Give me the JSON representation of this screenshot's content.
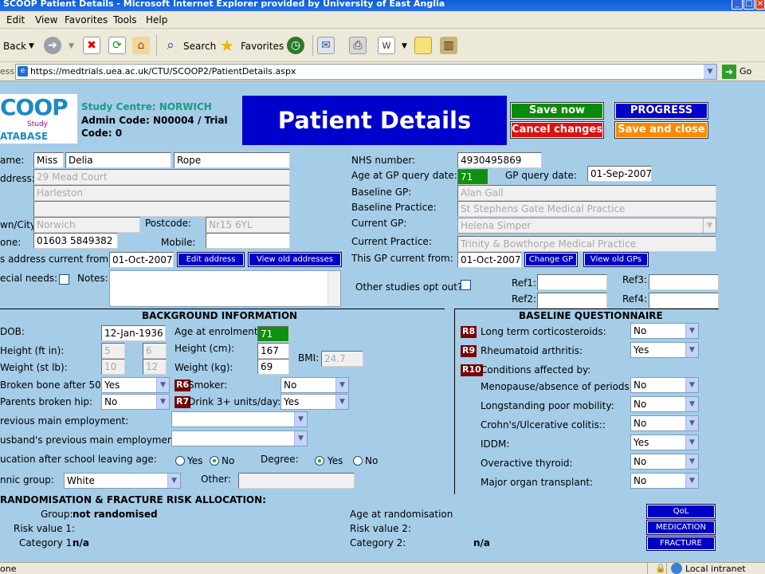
{
  "window": {
    "title": "SCOOP Patient Details - Microsoft Internet Explorer provided by University of East Anglia"
  },
  "menu": [
    "Edit",
    "View",
    "Favorites",
    "Tools",
    "Help"
  ],
  "toolbar": {
    "back": "Back",
    "search": "Search",
    "favorites": "Favorites"
  },
  "address": {
    "label": "ess",
    "url": "https://medtrials.uea.ac.uk/CTU/SCOOP2/PatientDetails.aspx",
    "go": "Go"
  },
  "header": {
    "logo_text": "COOP",
    "logo_study": "Study",
    "logo_database": "ATABASE",
    "centre": "Study Centre: NORWICH",
    "admin_line1": "Admin Code: N00004 / Trial",
    "admin_line2": "Code: 0",
    "page_title": "Patient Details",
    "save_now": "Save now",
    "cancel_changes": "Cancel changes",
    "progress": "PROGRESS",
    "save_and_close": "Save and close"
  },
  "patient": {
    "name_label": "ame:",
    "title": "Miss",
    "first_name": "Delia",
    "surname": "Rope",
    "address_label": "ddress:",
    "address1": "29 Mead Court",
    "address2": "Harleston",
    "address3": "",
    "town_label": "wn/City:",
    "town": "Norwich",
    "postcode_label": "Postcode:",
    "postcode": "Nr15 6YL",
    "phone_label": "one:",
    "phone": "01603 5849382",
    "mobile_label": "Mobile:",
    "mobile": "",
    "address_from_label": "s address current from:",
    "address_from": "01-Oct-2007",
    "edit_address": "Edit address",
    "view_old_addresses": "View old addresses",
    "special_needs_label": "ecial needs:",
    "notes_label": "Notes:"
  },
  "gp": {
    "nhs_label": "NHS number:",
    "nhs": "4930495869",
    "age_gp_label": "Age at GP query date:",
    "age_gp": "71",
    "gp_query_label": "GP query date:",
    "gp_query_date": "01-Sep-2007",
    "baseline_gp_label": "Baseline GP:",
    "baseline_gp": "Alan  Gall",
    "baseline_practice_label": "Baseline Practice:",
    "baseline_practice": "St Stephens Gate Medical Practice",
    "current_gp_label": "Current GP:",
    "current_gp": "Helena Simper",
    "current_practice_label": "Current Practice:",
    "current_practice": "Trinity & Bowthorpe Medical Practice",
    "gp_from_label": "This GP current from:",
    "gp_from": "01-Oct-2007",
    "change_gp": "Change GP",
    "view_old_gps": "View old GPs",
    "opt_out_label": "Other studies opt out?:",
    "ref1_label": "Ref1:",
    "ref2_label": "Ref2:",
    "ref3_label": "Ref3:",
    "ref4_label": "Ref4:"
  },
  "background": {
    "heading": "BACKGROUND INFORMATION",
    "dob_label": "DOB:",
    "dob": "12-Jan-1936",
    "age_enrol_label": "Age at enrolment:",
    "age_enrol": "71",
    "height_ftin_label": "Height (ft in):",
    "height_ft": "5",
    "height_in": "6",
    "height_cm_label": "Height (cm):",
    "height_cm": "167",
    "weight_stlb_label": "Weight (st lb):",
    "weight_st": "10",
    "weight_lb": "12",
    "weight_kg_label": "Weight (kg):",
    "weight_kg": "69",
    "bmi_label": "BMI:",
    "bmi": "24.7",
    "broken_label": "Broken bone after 50:",
    "broken": "Yes",
    "parents_label": "Parents broken hip:",
    "parents": "No",
    "r6": "R6",
    "smoker_label": "Smoker:",
    "smoker": "No",
    "r7": "R7",
    "drink_label": "Drink 3+ units/day:",
    "drink": "Yes",
    "employment_label": "revious main employment:",
    "husband_label": "usband's previous main employment:",
    "education_label": "ucation after school leaving age:",
    "yes": "Yes",
    "no": "No",
    "degree_label": "Degree:",
    "ethnic_label": "nnic group:",
    "ethnic": "White",
    "other_label": "Other:"
  },
  "questionnaire": {
    "heading": "BASELINE QUESTIONNAIRE",
    "r8": "R8",
    "cortico_label": "Long term corticosteroids:",
    "cortico": "No",
    "r9": "R9",
    "rheum_label": "Rheumatoid arthritis:",
    "rheum": "Yes",
    "r10": "R10",
    "conditions_label": "Conditions affected by:",
    "menopause_label": "Menopause/absence of periods:",
    "menopause": "No",
    "immobility_label": "Longstanding poor mobility:",
    "immobility": "No",
    "crohns_label": "Crohn's/Ulcerative colitis::",
    "crohns": "No",
    "iddm_label": "IDDM:",
    "iddm": "Yes",
    "thyroid_label": "Overactive thyroid:",
    "thyroid": "No",
    "transplant_label": "Major organ transplant:",
    "transplant": "No"
  },
  "randomisation": {
    "heading": "RANDOMISATION & FRACTURE RISK ALLOCATION:",
    "group_label": "Group:",
    "group": "not randomised",
    "risk1_label": "Risk value 1:",
    "category1_label": "Category 1:",
    "category1": "n/a",
    "age_rand_label": "Age at randomisation",
    "risk2_label": "Risk value 2:",
    "category2_label": "Category 2:",
    "category2": "n/a",
    "qol": "QoL",
    "medication": "MEDICATION",
    "fracture": "FRACTURE"
  },
  "status": {
    "left": "one",
    "zone": "Local intranet"
  },
  "colors": {
    "save": "#0a8a0a",
    "cancel": "#e01010",
    "progress": "#0000c8",
    "save_close": "#ff8800",
    "title_bg": "#0000cc",
    "page_bg": "#a5cde8"
  }
}
